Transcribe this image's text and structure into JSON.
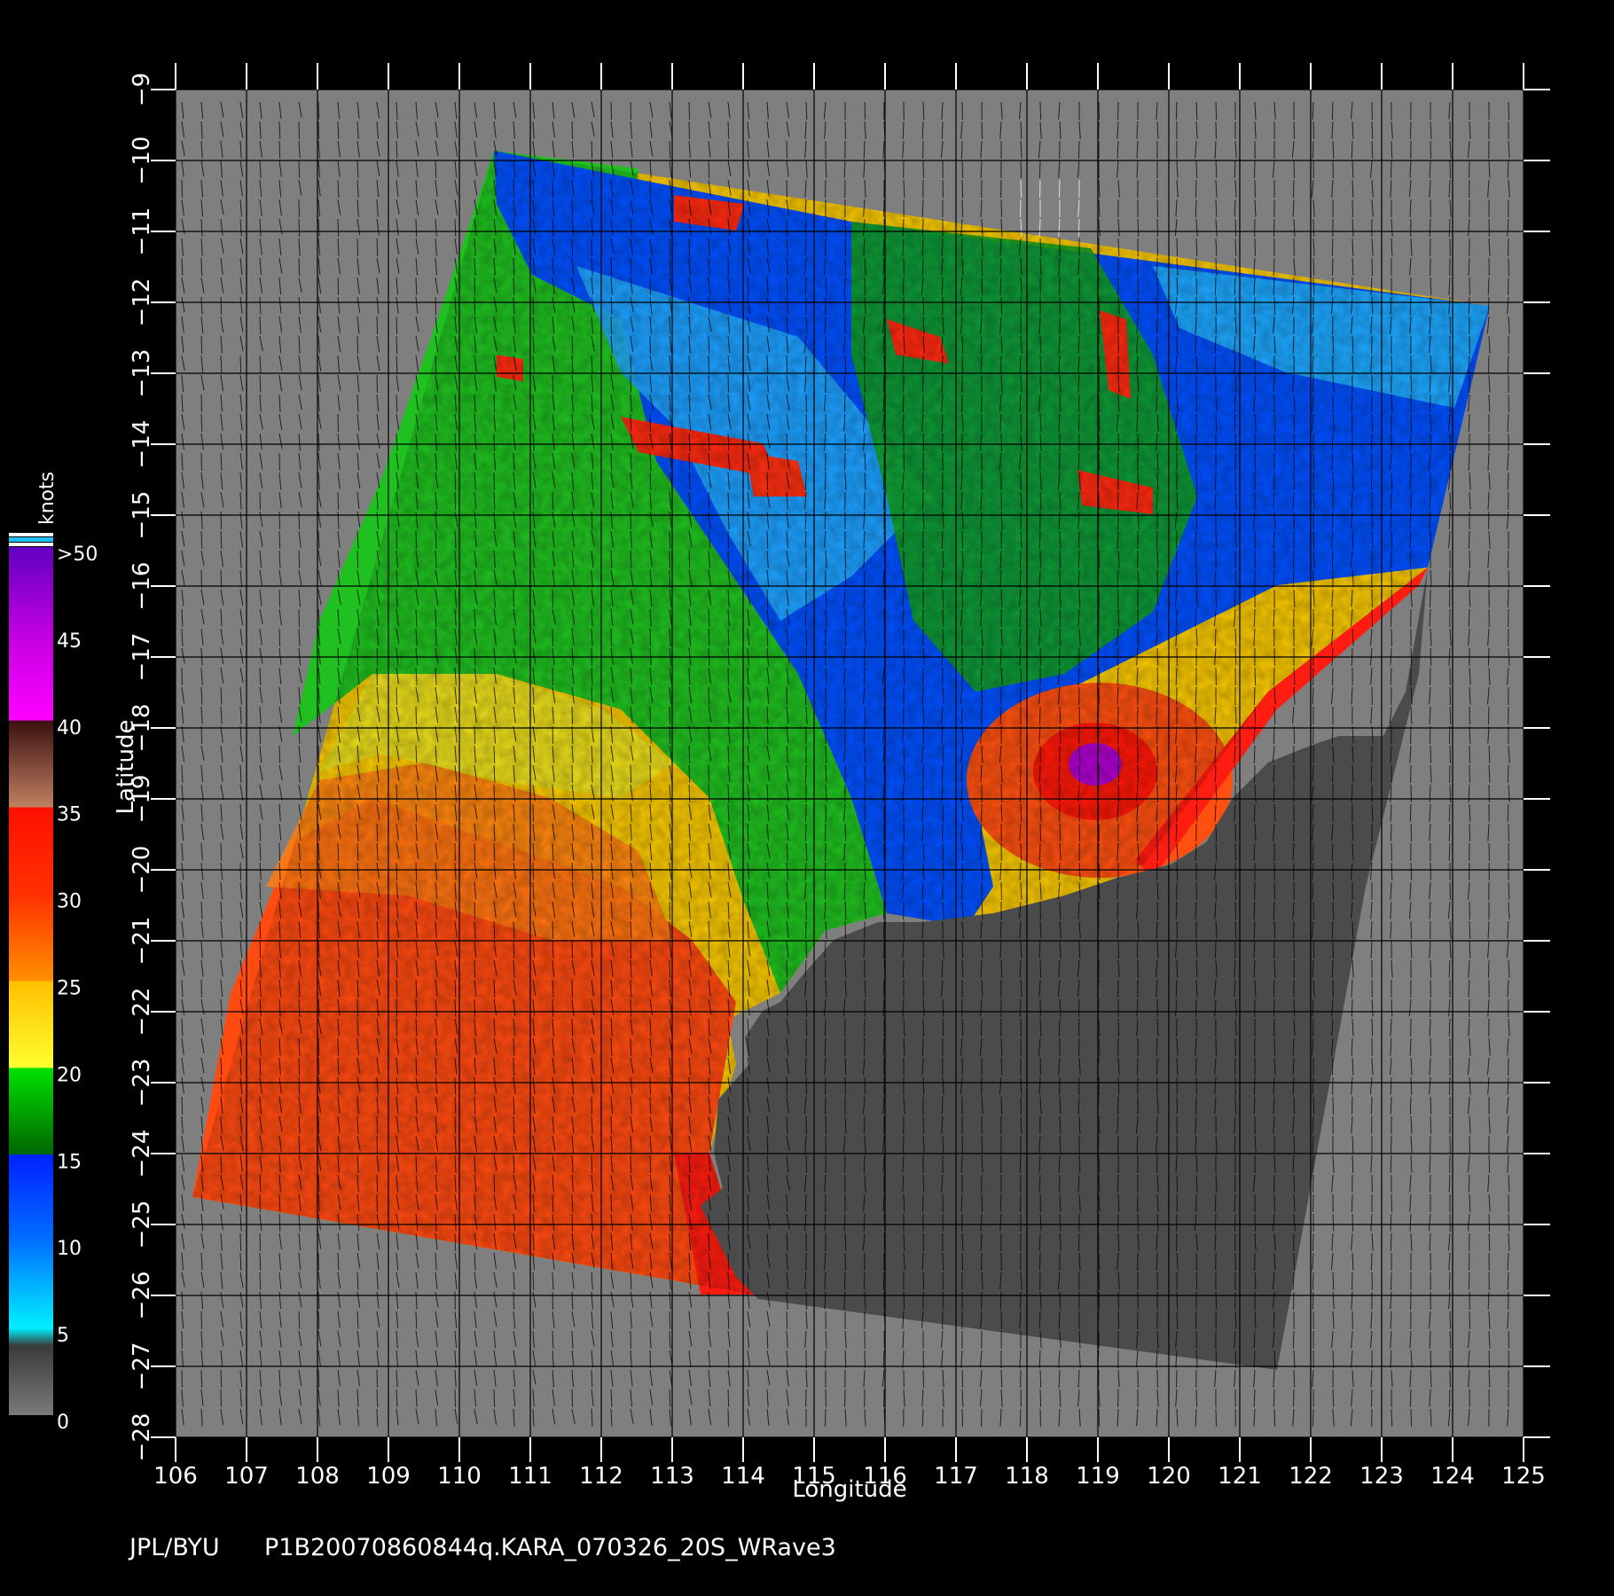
{
  "map": {
    "lon_range": [
      106,
      125
    ],
    "lat_range": [
      -28,
      -9
    ],
    "lon_ticks": [
      106,
      107,
      108,
      109,
      110,
      111,
      112,
      113,
      114,
      115,
      116,
      117,
      118,
      119,
      120,
      121,
      122,
      123,
      124,
      125
    ],
    "lat_ticks": [
      -9,
      -10,
      -11,
      -12,
      -13,
      -14,
      -15,
      -16,
      -17,
      -18,
      -19,
      -20,
      -21,
      -22,
      -23,
      -24,
      -25,
      -26,
      -27,
      -28
    ],
    "xlabel": "Longitude",
    "ylabel": "Latitude",
    "land_color": "#4b4b4b",
    "nodata_color": "#7f7f7f",
    "grid_color": "#000000"
  },
  "colorbar": {
    "unit": "knots",
    "labels": [
      ">50",
      "45",
      "40",
      "35",
      "30",
      "25",
      "20",
      "15",
      "10",
      "5",
      "0"
    ],
    "stops": [
      {
        "value": 0,
        "color": "#7a7a7a"
      },
      {
        "value": 4,
        "color": "#3a3a3a"
      },
      {
        "value": 5,
        "color": "#00f0ff"
      },
      {
        "value": 10,
        "color": "#0070ff"
      },
      {
        "value": 15,
        "color": "#0020ff"
      },
      {
        "value": 15.01,
        "color": "#006600"
      },
      {
        "value": 20,
        "color": "#00e000"
      },
      {
        "value": 20.01,
        "color": "#ffff30"
      },
      {
        "value": 25,
        "color": "#ffc000"
      },
      {
        "value": 25.01,
        "color": "#ff9000"
      },
      {
        "value": 30,
        "color": "#ff3000"
      },
      {
        "value": 35,
        "color": "#ff1000"
      },
      {
        "value": 35.01,
        "color": "#c08060"
      },
      {
        "value": 40,
        "color": "#3a1010"
      },
      {
        "value": 40.01,
        "color": "#ff00ff"
      },
      {
        "value": 45,
        "color": "#c000e0"
      },
      {
        "value": 50,
        "color": "#6000c0"
      }
    ]
  },
  "footer": {
    "source": "JPL/BYU",
    "product": "P1B20070860844q.KARA_070326_20S_WRave3"
  }
}
